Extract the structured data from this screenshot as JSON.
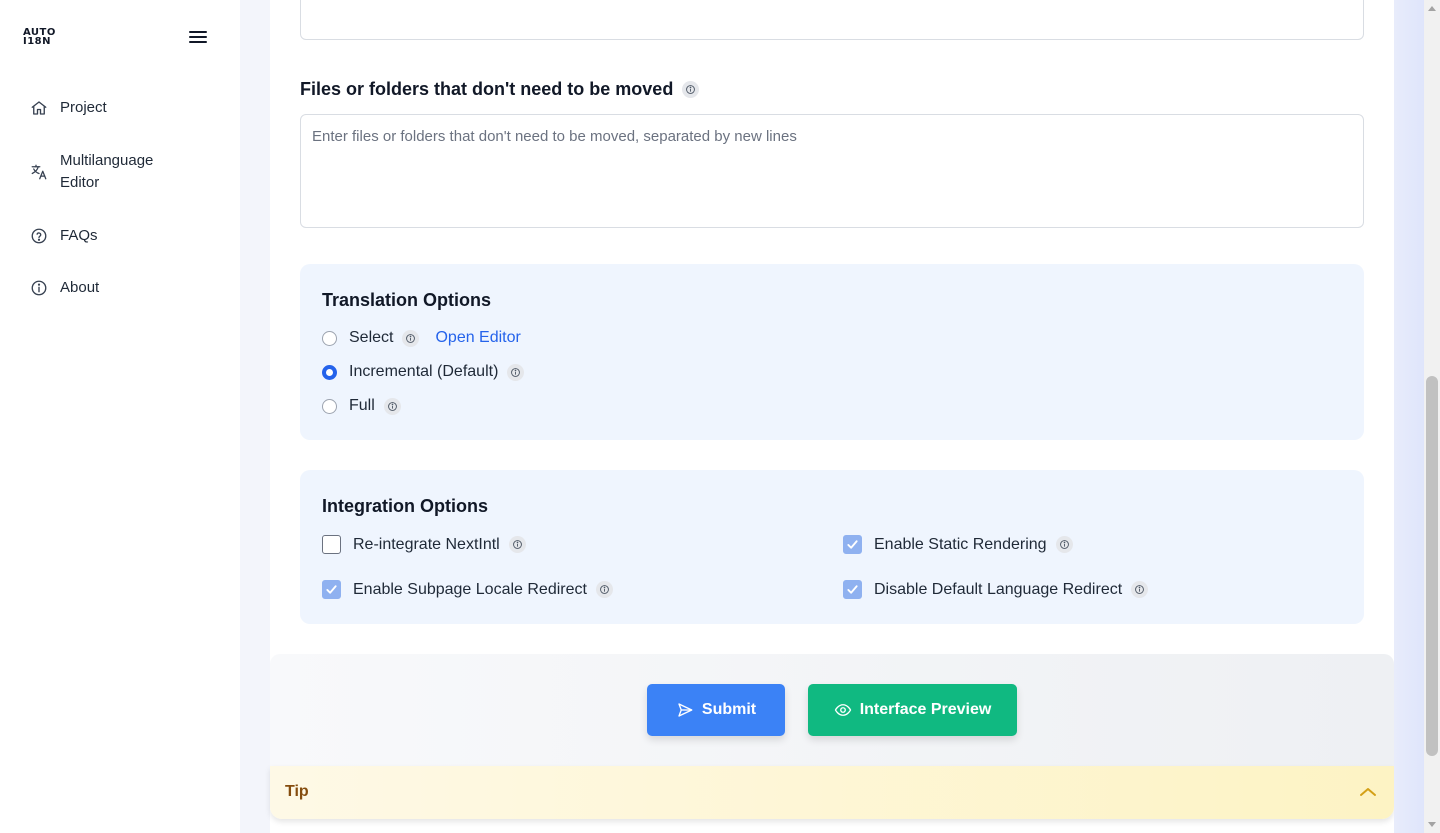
{
  "sidebar": {
    "logo": [
      "AUTO",
      "I18N"
    ],
    "items": [
      {
        "label": "Project",
        "icon": "home-icon"
      },
      {
        "label": "Multilanguage Editor",
        "icon": "translate-icon"
      },
      {
        "label": "FAQs",
        "icon": "help-circle-icon"
      },
      {
        "label": "About",
        "icon": "info-circle-icon"
      }
    ]
  },
  "exclude": {
    "title": "Files or folders that don't need to be moved",
    "placeholder": "Enter files or folders that don't need to be moved, separated by new lines"
  },
  "translation": {
    "title": "Translation Options",
    "options": [
      {
        "label": "Select",
        "selected": false,
        "link": "Open Editor"
      },
      {
        "label": "Incremental (Default)",
        "selected": true
      },
      {
        "label": "Full",
        "selected": false
      }
    ]
  },
  "integration": {
    "title": "Integration Options",
    "options": [
      {
        "label": "Re-integrate NextIntl",
        "checked": false
      },
      {
        "label": "Enable Static Rendering",
        "checked": true
      },
      {
        "label": "Enable Subpage Locale Redirect",
        "checked": true
      },
      {
        "label": "Disable Default Language Redirect",
        "checked": true
      }
    ]
  },
  "actions": {
    "submit": "Submit",
    "preview": "Interface Preview"
  },
  "tip": {
    "label": "Tip"
  },
  "colors": {
    "primary": "#3b82f6",
    "success": "#10b981",
    "panel": "#eff5fe",
    "link": "#2563eb"
  }
}
